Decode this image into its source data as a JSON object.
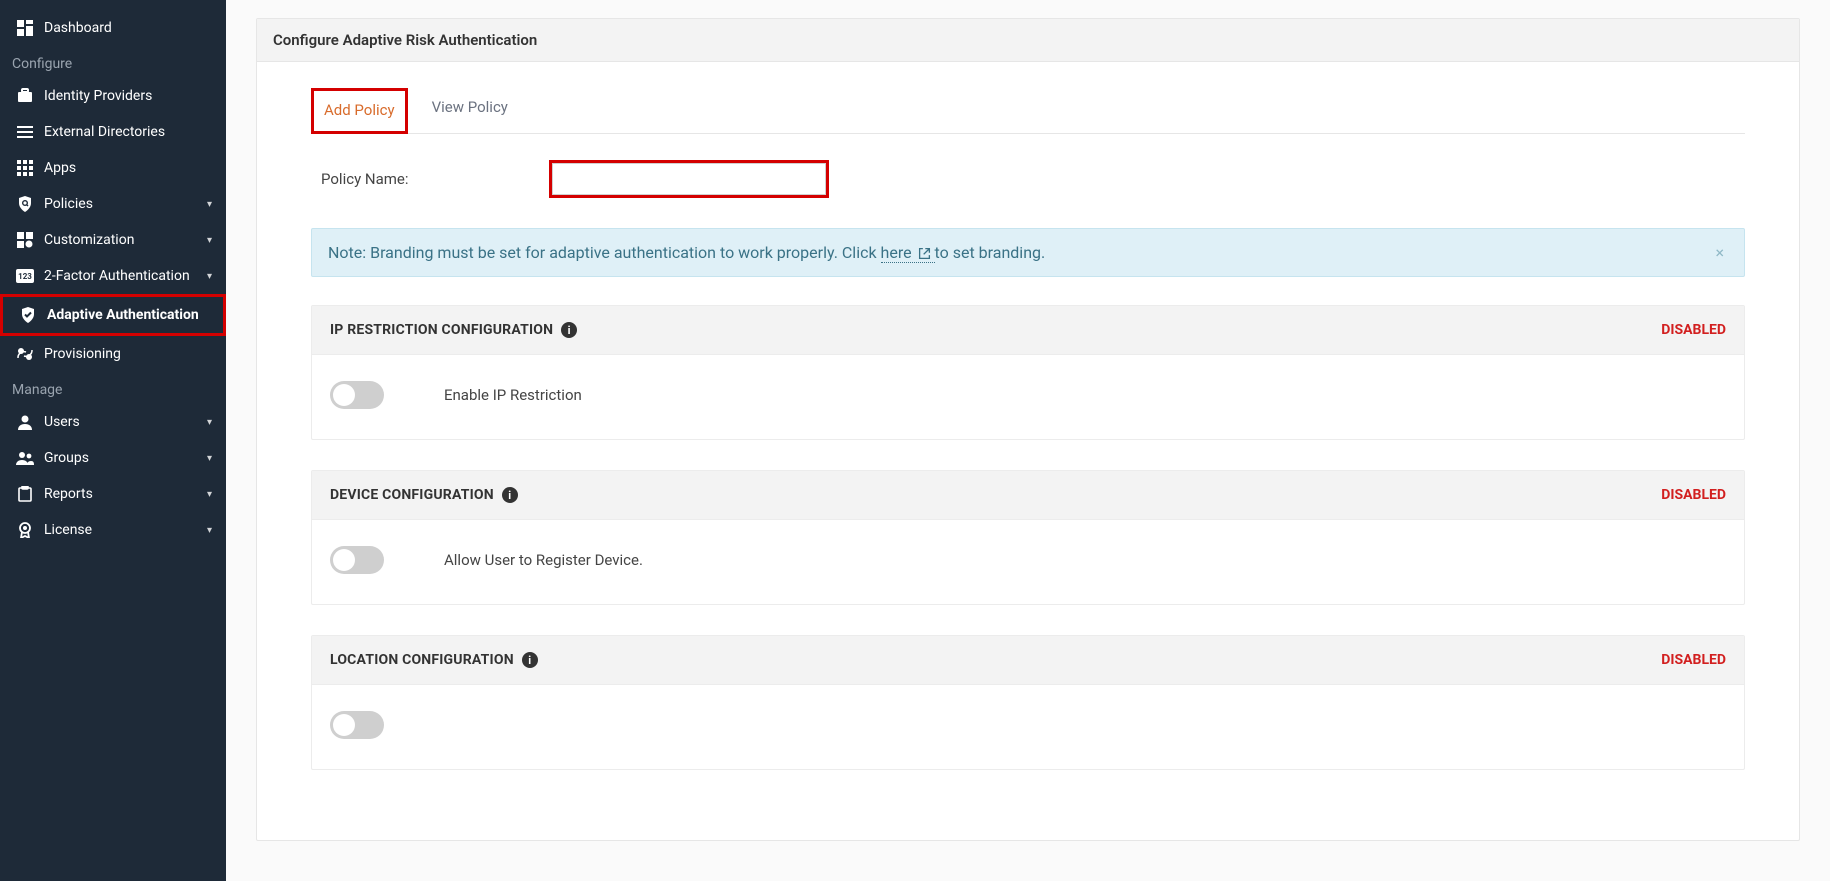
{
  "sidebar": {
    "sections": [
      {
        "type": "item",
        "key": "dashboard",
        "label": "Dashboard",
        "icon": "dashboard",
        "expandable": false
      },
      {
        "type": "section",
        "label": "Configure"
      },
      {
        "type": "item",
        "key": "idp",
        "label": "Identity Providers",
        "icon": "briefcase",
        "expandable": false
      },
      {
        "type": "item",
        "key": "extdir",
        "label": "External Directories",
        "icon": "list",
        "expandable": false
      },
      {
        "type": "item",
        "key": "apps",
        "label": "Apps",
        "icon": "grid",
        "expandable": false
      },
      {
        "type": "item",
        "key": "policies",
        "label": "Policies",
        "icon": "shield-search",
        "expandable": true
      },
      {
        "type": "item",
        "key": "customization",
        "label": "Customization",
        "icon": "puzzle",
        "expandable": true
      },
      {
        "type": "item",
        "key": "twofa",
        "label": "2-Factor Authentication",
        "icon": "badge-123",
        "expandable": true
      },
      {
        "type": "item",
        "key": "adaptive",
        "label": "Adaptive Authentication",
        "icon": "shield-check",
        "expandable": false,
        "active": true,
        "highlight": true
      },
      {
        "type": "item",
        "key": "provisioning",
        "label": "Provisioning",
        "icon": "sync-users",
        "expandable": false
      },
      {
        "type": "section",
        "label": "Manage"
      },
      {
        "type": "item",
        "key": "users",
        "label": "Users",
        "icon": "user",
        "expandable": true
      },
      {
        "type": "item",
        "key": "groups",
        "label": "Groups",
        "icon": "users",
        "expandable": true
      },
      {
        "type": "item",
        "key": "reports",
        "label": "Reports",
        "icon": "clipboard",
        "expandable": true
      },
      {
        "type": "item",
        "key": "license",
        "label": "License",
        "icon": "award",
        "expandable": true
      }
    ]
  },
  "page": {
    "title": "Configure Adaptive Risk Authentication",
    "tabs": {
      "add": "Add Policy",
      "view": "View Policy"
    },
    "policy_name_label": "Policy Name:",
    "policy_name_value": "",
    "alert": {
      "prefix": "Note: Branding must be set for adaptive authentication to work properly. Click ",
      "link_text": "here",
      "suffix": " to set branding."
    },
    "cards": [
      {
        "title": "IP RESTRICTION CONFIGURATION",
        "status": "DISABLED",
        "toggle_label": "Enable IP Restriction",
        "on": false
      },
      {
        "title": "DEVICE CONFIGURATION",
        "status": "DISABLED",
        "toggle_label": "Allow User to Register Device.",
        "on": false
      },
      {
        "title": "LOCATION CONFIGURATION",
        "status": "DISABLED",
        "toggle_label": "",
        "on": false
      }
    ]
  }
}
